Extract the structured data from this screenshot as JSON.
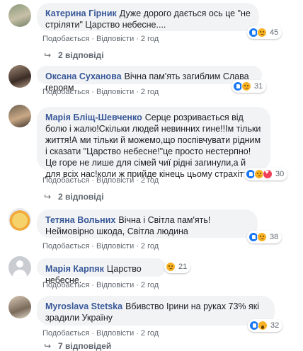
{
  "labels": {
    "like": "Подобається",
    "reply": "Відповісти",
    "sep": "·"
  },
  "comments": [
    {
      "author": "Катерина Гірник",
      "text": "Дуже дорого дається ось це \"не стріляти\" Царство небесне....",
      "time": "2 год",
      "reactions": [
        "like-icon",
        "sad-icon"
      ],
      "count": "45",
      "replies": "2 відповіді"
    },
    {
      "author": "Оксана Суханова",
      "text": "Вічна пам'ять загиблим Слава героям",
      "time": "2 год",
      "reactions": [
        "like-icon",
        "sad-icon"
      ],
      "count": "31"
    },
    {
      "author": "Марія Бліщ-Шевченко",
      "text": "Серце розривається від болю і жалю!Скільки людей невинних гине!!Ім тільки життя!А ми тільки й можемо,що поспівчувати рідним і сказати \"Царство небесне!\"це просто нестерпно!Це горе не лише для сімей чиї рідні загинули,а й для всіх нас!коли ж прийде кінець цьому страхіттю?",
      "time": "2 год",
      "reactions": [
        "like-icon",
        "sad-icon",
        "love-icon"
      ],
      "count": "30",
      "replies": "2 відповіді"
    },
    {
      "author": "Тетяна Вольних",
      "text": "Вічна і Світла пам'ять! Неймовірно шкода, Світла людина",
      "time": "2 год",
      "reactions": [
        "like-icon",
        "sad-icon"
      ],
      "count": "38"
    },
    {
      "author": "Марія Карпяк",
      "text": "Царство небесне.",
      "time": "2 год",
      "reactions": [
        "sad-icon"
      ],
      "count": "21"
    },
    {
      "author": "Myroslava Stetska",
      "text": "Вбивство Ірини на руках 73% які зрадили Україну",
      "time": "2 год",
      "reactions": [
        "like-icon",
        "wow-icon"
      ],
      "count": "32",
      "replies": "7 відповідей"
    }
  ]
}
